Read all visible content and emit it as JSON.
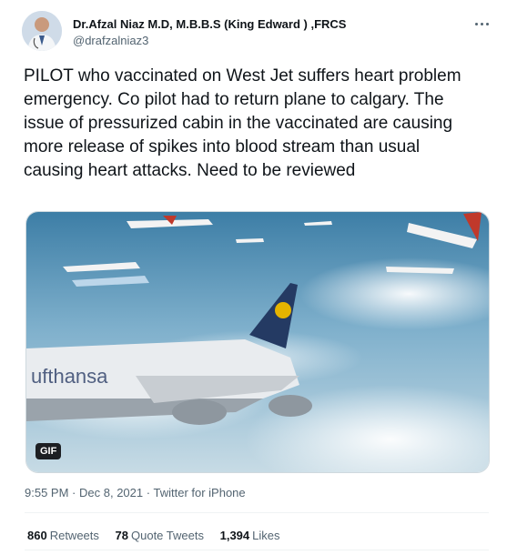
{
  "author": {
    "display_name": "Dr.Afzal Niaz M.D, M.B.B.S (King Edward ) ,FRCS",
    "handle": "@drafzalniaz3"
  },
  "tweet": {
    "text": "PILOT who vaccinated on West Jet suffers heart problem emergency. Co pilot had to return plane to calgary. The issue of  pressurized cabin in the vaccinated are causing more release of spikes into blood stream than usual causing heart attacks. Need to be reviewed",
    "media_badge": "GIF",
    "time": "9:55 PM",
    "date": "Dec 8, 2021",
    "source": "Twitter for iPhone",
    "separator": "·"
  },
  "stats": {
    "retweets_count": "860",
    "retweets_label": "Retweets",
    "quotes_count": "78",
    "quotes_label": "Quote Tweets",
    "likes_count": "1,394",
    "likes_label": "Likes"
  },
  "colors": {
    "text_primary": "#0f1419",
    "text_secondary": "#536471",
    "divider": "#eff3f4"
  },
  "icons": [
    "more-options-icon",
    "avatar-photo"
  ]
}
